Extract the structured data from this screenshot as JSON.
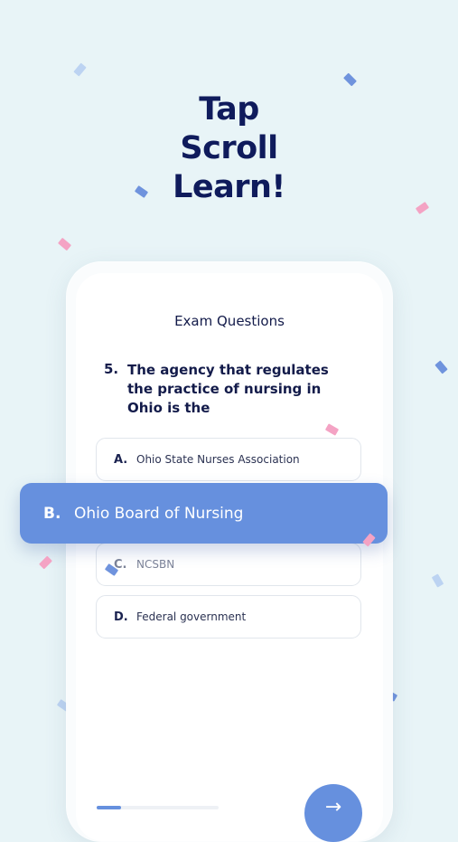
{
  "headline": {
    "line1": "Tap",
    "line2": "Scroll",
    "line3": "Learn!"
  },
  "screen": {
    "title": "Exam Questions"
  },
  "question": {
    "number": "5.",
    "text": "The agency that regulates the practice of nursing in Ohio is the"
  },
  "options": [
    {
      "letter": "A.",
      "text": "Ohio State Nurses Association"
    },
    {
      "letter": "B.",
      "text": "Ohio Board of Nursing",
      "selected": true
    },
    {
      "letter": "C.",
      "text": "NCSBN"
    },
    {
      "letter": "D.",
      "text": "Federal government"
    }
  ],
  "progress": {
    "fraction": 0.2
  },
  "next_button": {
    "icon": "arrow-right-icon",
    "glyph": "→"
  },
  "colors": {
    "accent": "#6690de",
    "navy": "#0f1b5c",
    "background": "#e8f4f7",
    "confetti_pink": "#f4a3c4",
    "confetti_blue": "#6f93dd",
    "confetti_light": "#bcd3f2"
  }
}
